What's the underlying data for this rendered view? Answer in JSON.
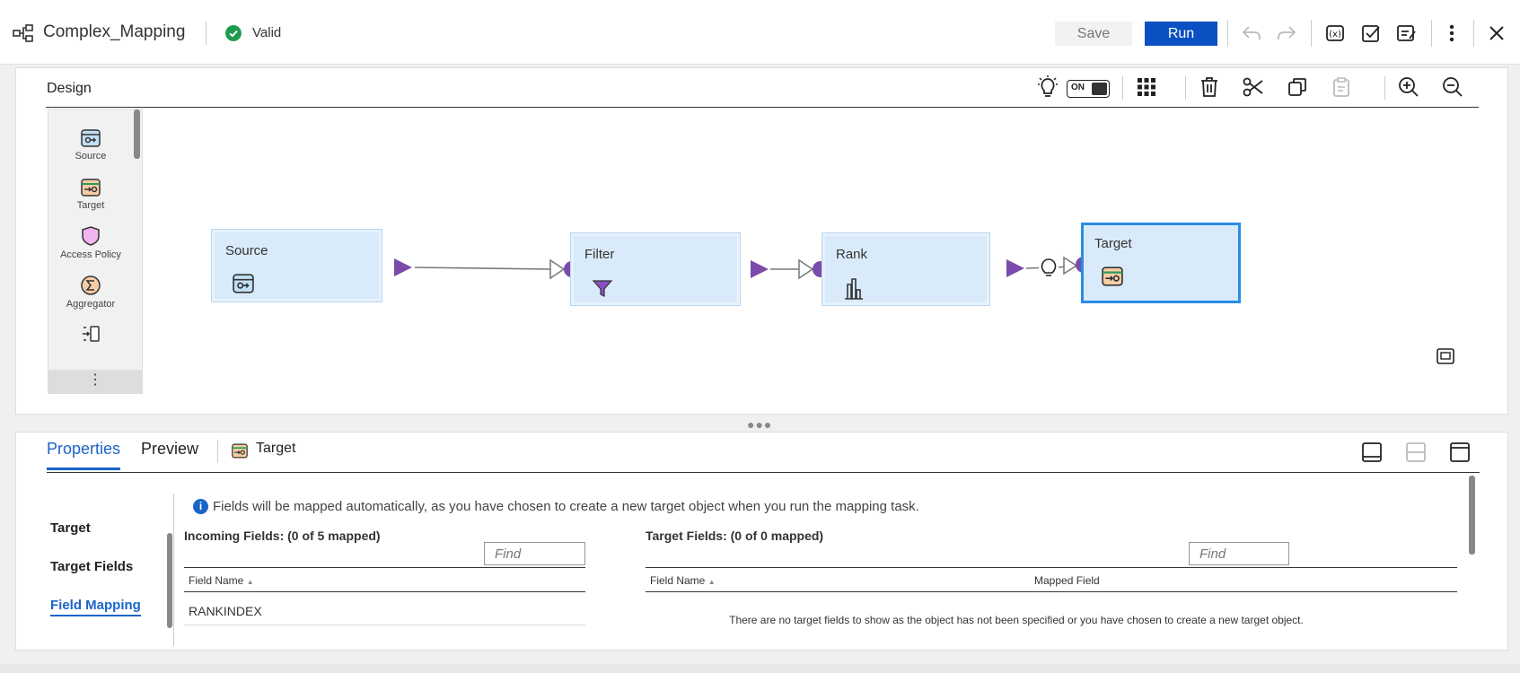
{
  "header": {
    "title": "Complex_Mapping",
    "status": "Valid",
    "save_label": "Save",
    "run_label": "Run",
    "toolbar_icons": [
      "undo-icon",
      "redo-icon",
      "parameters-icon",
      "validate-icon",
      "properties-icon",
      "more-vertical-icon",
      "close-icon"
    ]
  },
  "design": {
    "title": "Design",
    "toggle_label": "ON",
    "palette": [
      "Source",
      "Target",
      "Access Policy",
      "Aggregator"
    ],
    "nodes": [
      {
        "label": "Source",
        "icon": "source-icon"
      },
      {
        "label": "Filter",
        "icon": "filter-icon"
      },
      {
        "label": "Rank",
        "icon": "rank-icon"
      },
      {
        "label": "Target",
        "icon": "target-icon",
        "selected": true
      }
    ]
  },
  "properties": {
    "tabs": [
      "Properties",
      "Preview"
    ],
    "active_tab": "Properties",
    "object_label": "Target",
    "nav": [
      "Target",
      "Target Fields",
      "Field Mapping"
    ],
    "active_nav": "Field Mapping",
    "info": "Fields will be mapped automatically, as you have chosen to create a new target object when you run the mapping task.",
    "incoming": {
      "title": "Incoming Fields: (0 of 5 mapped)",
      "find_placeholder": "Find",
      "column": "Field Name",
      "rows": [
        "RANKINDEX"
      ]
    },
    "target": {
      "title": "Target Fields: (0 of 0 mapped)",
      "find_placeholder": "Find",
      "columns": [
        "Field Name",
        "Mapped Field"
      ],
      "empty_message": "There are no target fields to show as the object has not been specified or you have chosen to create a new target object."
    }
  }
}
